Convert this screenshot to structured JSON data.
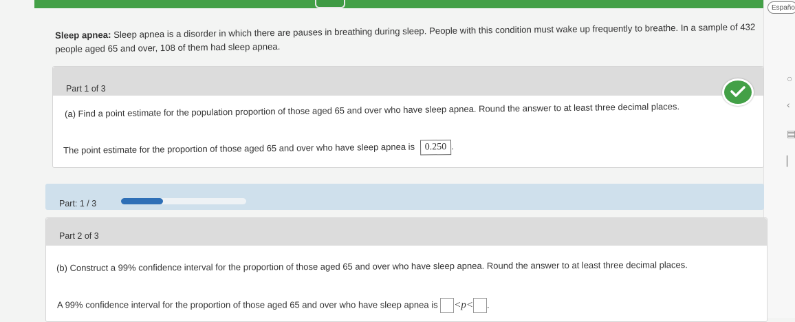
{
  "language_button": "Español",
  "problem": {
    "title": "Sleep apnea:",
    "text": "Sleep apnea is a disorder in which there are pauses in breathing during sleep. People with this condition must wake up frequently to breathe. In a sample of 432 people aged 65 and over, 108 of them had sleep apnea."
  },
  "part1": {
    "label": "Part 1 of 3",
    "question": "(a) Find a point estimate for the population proportion of those aged 65 and over who have sleep apnea. Round the answer to at least three decimal places.",
    "answer_prefix": "The point estimate for the proportion of those aged 65 and over who have sleep apnea is",
    "answer_value": "0.250",
    "answer_suffix": ".",
    "status": "correct"
  },
  "progress": {
    "label": "Part: 1 / 3",
    "fraction": 0.333
  },
  "part2": {
    "label": "Part 2 of 3",
    "question": "(b) Construct a 99% confidence interval for the proportion of those aged 65 and over who have sleep apnea. Round the answer to at least three decimal places.",
    "answer_prefix": "A 99% confidence interval for the proportion of those aged 65 and over who have sleep apnea is",
    "interval_symbol": "<p<",
    "answer_suffix": "."
  },
  "colors": {
    "accent_green": "#43a047",
    "progress_blue": "#2e6fb6"
  }
}
